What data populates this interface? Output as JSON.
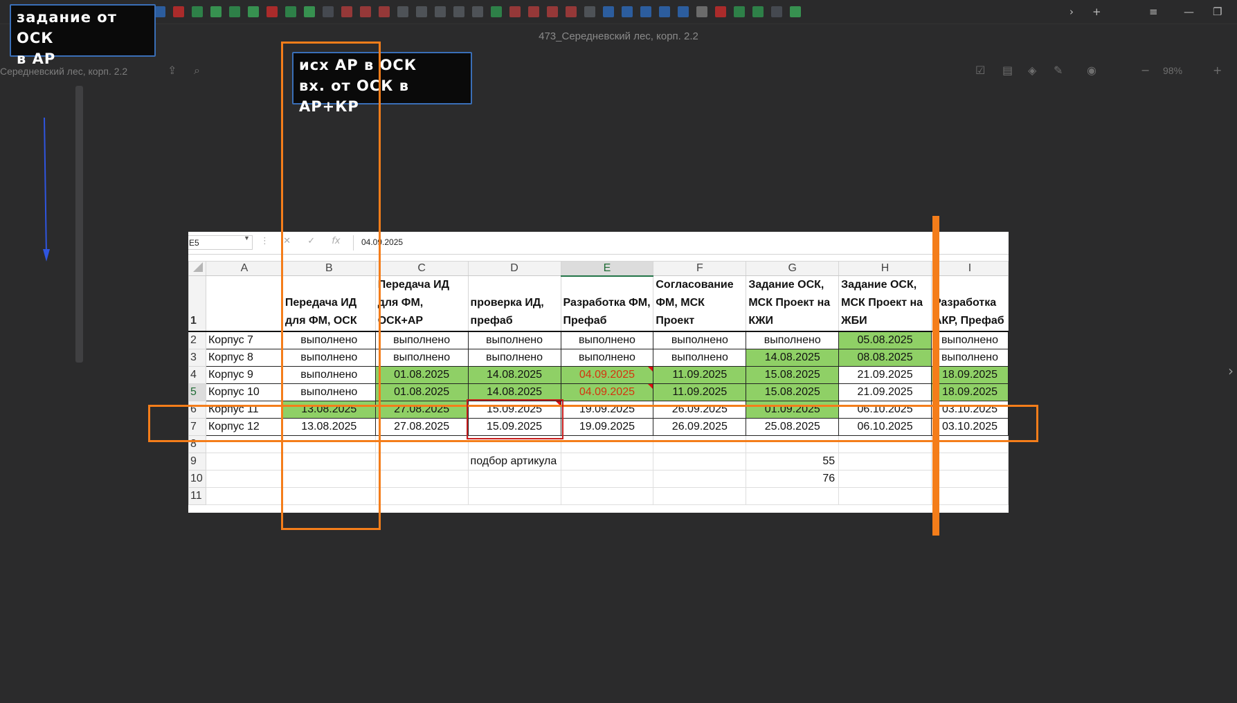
{
  "window": {
    "title": "473_Середневский лес, корп. 2.2",
    "tab_title": "Середневский лес, корп. 2.2",
    "zoom": "98%",
    "minimize": "—",
    "restore": "❐"
  },
  "annotations": {
    "label1": [
      "задание от ОСК",
      "в АР"
    ],
    "label2": [
      "исх АР в ОСК",
      "вх. от ОСК в АР+КР"
    ]
  },
  "sheet": {
    "name_box": "E5",
    "formula_value": "04.09.2025",
    "columns": [
      "A",
      "B",
      "C",
      "D",
      "E",
      "F",
      "G",
      "H",
      "I"
    ],
    "selected_column": "E",
    "selected_row": "5",
    "header_row": {
      "row": "1",
      "cells": [
        "",
        "Передача ИД для ФМ, ОСК",
        "Передача ИД для ФМ, ОСК+АР",
        "проверка ИД, префаб",
        "Разработка ФМ, Префаб",
        "Согласование ФМ, МСК Проект",
        "Задание ОСК, МСК Проект на КЖИ",
        "Задание ОСК, МСК Проект на ЖБИ",
        "Разработка АКР, Префаб"
      ]
    },
    "rows": [
      {
        "row": "2",
        "name": "Корпус 7",
        "cells": [
          "выполнено",
          "выполнено",
          "выполнено",
          "выполнено",
          "выполнено",
          "выполнено",
          "05.08.2025",
          "выполнено"
        ]
      },
      {
        "row": "3",
        "name": "Корпус 8",
        "cells": [
          "выполнено",
          "выполнено",
          "выполнено",
          "выполнено",
          "выполнено",
          "14.08.2025",
          "08.08.2025",
          "выполнено"
        ]
      },
      {
        "row": "4",
        "name": "Корпус 9",
        "cells": [
          "выполнено",
          "01.08.2025",
          "14.08.2025",
          "04.09.2025",
          "11.09.2025",
          "15.08.2025",
          "21.09.2025",
          "18.09.2025"
        ]
      },
      {
        "row": "5",
        "name": "Корпус 10",
        "cells": [
          "выполнено",
          "01.08.2025",
          "14.08.2025",
          "04.09.2025",
          "11.09.2025",
          "15.08.2025",
          "21.09.2025",
          "18.09.2025"
        ]
      },
      {
        "row": "6",
        "name": "Корпус 11",
        "cells": [
          "13.08.2025",
          "27.08.2025",
          "15.09.2025",
          "19.09.2025",
          "26.09.2025",
          "01.09.2025",
          "06.10.2025",
          "03.10.2025"
        ]
      },
      {
        "row": "7",
        "name": "Корпус 12",
        "cells": [
          "13.08.2025",
          "27.08.2025",
          "15.09.2025",
          "19.09.2025",
          "26.09.2025",
          "25.08.2025",
          "06.10.2025",
          "03.10.2025"
        ]
      }
    ],
    "extra_rows": [
      {
        "row": "8",
        "d": "",
        "g": ""
      },
      {
        "row": "9",
        "d": "подбор артикула",
        "g": "55"
      },
      {
        "row": "10",
        "d": "",
        "g": "76"
      },
      {
        "row": "11",
        "d": "",
        "g": ""
      }
    ],
    "colors": {
      "green": "#8fd066",
      "red_text": "#d4340f",
      "annotation_orange": "#f47d1a",
      "annotation_red": "#c81d1d",
      "arrow_blue": "#2f55e0"
    },
    "green_cells": [
      [
        1,
        6
      ],
      [
        2,
        5
      ],
      [
        2,
        6
      ],
      [
        3,
        1
      ],
      [
        3,
        2
      ],
      [
        3,
        3
      ],
      [
        3,
        4
      ],
      [
        3,
        5
      ],
      [
        3,
        7
      ],
      [
        4,
        1
      ],
      [
        4,
        2
      ],
      [
        4,
        3
      ],
      [
        4,
        4
      ],
      [
        4,
        5
      ],
      [
        4,
        7
      ],
      [
        5,
        0
      ],
      [
        5,
        1
      ],
      [
        5,
        5
      ]
    ],
    "red_cells": [
      [
        3,
        3
      ],
      [
        4,
        3
      ]
    ],
    "comment_cells": [
      [
        3,
        3
      ],
      [
        4,
        3
      ],
      [
        5,
        2
      ]
    ]
  }
}
